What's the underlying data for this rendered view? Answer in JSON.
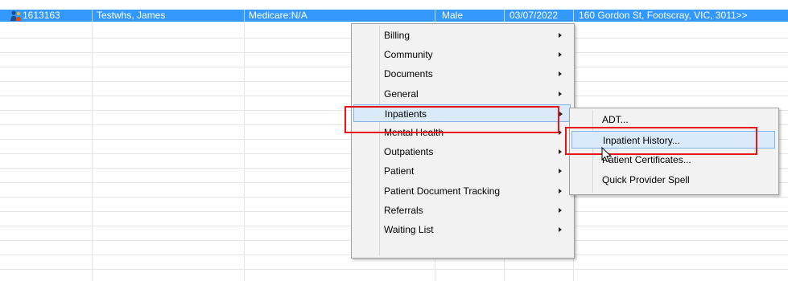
{
  "patient_row": {
    "id": "1613163",
    "name": "Testwhs, James",
    "medicare": "Medicare:N/A",
    "gender": "Male",
    "date": "03/07/2022",
    "address": "160 Gordon St, Footscray, VIC, 3011>>",
    "icon": "patient-icon",
    "highlight_color": "#3399ff"
  },
  "context_menu": {
    "items": [
      {
        "label": "Billing",
        "has_submenu": true
      },
      {
        "label": "Community",
        "has_submenu": true
      },
      {
        "label": "Documents",
        "has_submenu": true
      },
      {
        "label": "General",
        "has_submenu": true
      },
      {
        "label": "Inpatients",
        "has_submenu": true,
        "highlighted": true
      },
      {
        "label": "Mental Health",
        "has_submenu": true
      },
      {
        "label": "Outpatients",
        "has_submenu": true
      },
      {
        "label": "Patient",
        "has_submenu": true
      },
      {
        "label": "Patient Document Tracking",
        "has_submenu": true
      },
      {
        "label": "Referrals",
        "has_submenu": true
      },
      {
        "label": "Waiting List",
        "has_submenu": true
      }
    ]
  },
  "submenu": {
    "items": [
      {
        "label": "ADT..."
      },
      {
        "label": "Inpatient History...",
        "highlighted": true
      },
      {
        "label": "Patient Certificates..."
      },
      {
        "label": "Quick Provider Spell"
      }
    ]
  },
  "annotation_color": "#e8141b",
  "cursor": "arrow-cursor-icon"
}
